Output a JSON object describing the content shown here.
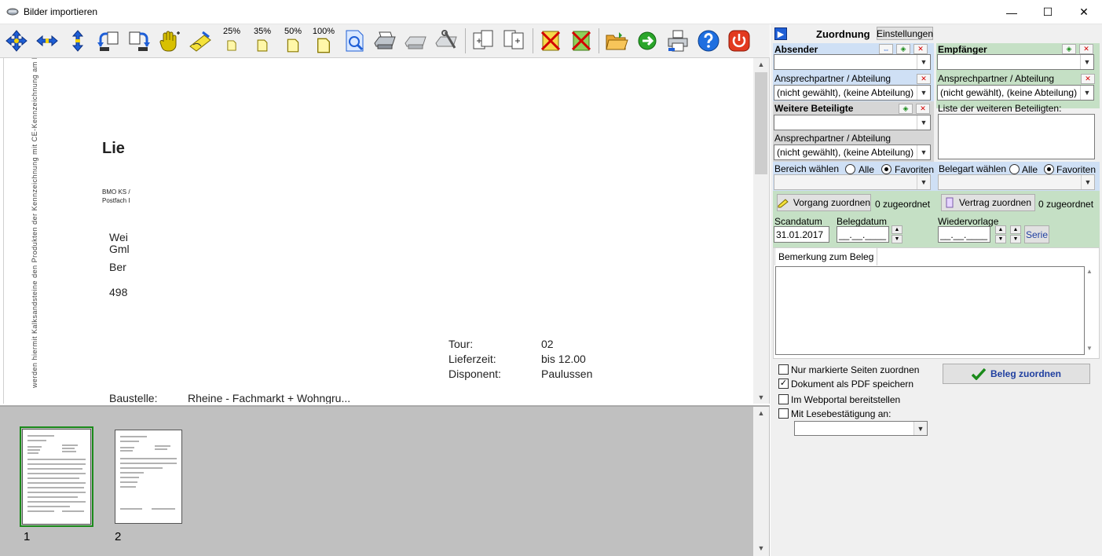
{
  "window": {
    "title": "Bilder importieren",
    "min": "—",
    "max": "☐",
    "close": "✕"
  },
  "toolbar": {
    "zoom": [
      "25%",
      "35%",
      "50%",
      "100%"
    ]
  },
  "document": {
    "heading": "Lie",
    "sender_line1": "BMO KS /",
    "sender_line2": "Postfach I",
    "addr1": "Wei",
    "addr2": "Gml",
    "addr3": "Ber",
    "addr4": "498",
    "side_text": "werden hiermit Kalksandsteine den Produkten der Kennzeichnung mit CE-Kennzeichnung am Produkt.",
    "tour_label": "Tour:",
    "tour_value": "02",
    "liefer_label": "Lieferzeit:",
    "liefer_value": "bis 12.00",
    "dispo_label": "Disponent:",
    "dispo_value": "Paulussen",
    "baustelle_label": "Baustelle:",
    "baustelle_value": "Rheine - Fachmarkt + Wohngru..."
  },
  "thumbnails": [
    {
      "num": "1"
    },
    {
      "num": "2"
    }
  ],
  "panel": {
    "title": "Zuordnung",
    "settings_tab": "Einstellungen",
    "absender": "Absender",
    "empfaenger": "Empfänger",
    "ansprech_label": "Ansprechpartner / Abteilung",
    "ansprech_value": "(nicht gewählt),   (keine Abteilung)",
    "weitere": "Weitere Beteiligte",
    "liste": "Liste der weiteren Beteiligten:",
    "bereich": "Bereich wählen",
    "belegart": "Belegart wählen",
    "alle": "Alle",
    "favoriten": "Favoriten",
    "vorgang_btn": "Vorgang zuordnen",
    "vorgang_count": "0 zugeordnet",
    "vertrag_btn": "Vertrag zuordnen",
    "vertrag_count": "0 zugeordnet",
    "scandatum": "Scandatum",
    "scandatum_value": "31.01.2017",
    "belegdatum": "Belegdatum",
    "belegdatum_value": "__.__.____",
    "wiedervorlage": "Wiedervorlage",
    "wiedervorlage_value": "__.__.____",
    "serie": "Serie",
    "bemerkung_tab": "Bemerkung zum Beleg",
    "cb_nur": "Nur markierte Seiten zuordnen",
    "cb_pdf": "Dokument als PDF speichern",
    "cb_web": "Im Webportal bereitstellen",
    "cb_lese": "Mit Lesebestätigung an:",
    "beleg_btn": "Beleg zuordnen"
  },
  "colors": {
    "blue_section": "#cfe0f5",
    "green_section": "#c5e0c5",
    "accent_green": "#1a8a1a"
  }
}
